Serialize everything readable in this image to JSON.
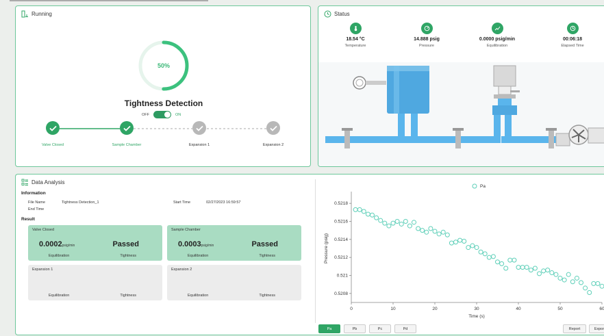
{
  "running": {
    "title": "Running",
    "progress_label": "50%",
    "progress_fraction": 0.5,
    "test_name": "Tightness Detection",
    "toggle_off": "OFF",
    "toggle_on": "ON",
    "toggle_state": "on",
    "steps": [
      {
        "label": "Valve Closed",
        "done": true
      },
      {
        "label": "Sample Chamber",
        "done": true
      },
      {
        "label": "Expansion 1",
        "done": false
      },
      {
        "label": "Expansion 2",
        "done": false
      }
    ]
  },
  "status": {
    "title": "Status",
    "items": [
      {
        "value": "18.54 °C",
        "label": "Temperature",
        "icon": "thermometer-icon"
      },
      {
        "value": "14.888 psig",
        "label": "Pressure",
        "icon": "gauge-icon"
      },
      {
        "value": "0.0000 psig/min",
        "label": "Equilibration",
        "icon": "trend-icon"
      },
      {
        "value": "00:06:18",
        "label": "Elapsed Time",
        "icon": "clock-icon"
      }
    ]
  },
  "analysis": {
    "title": "Data Analysis",
    "info_heading": "Information",
    "file_name_label": "File Name",
    "file_name": "Tightness Detection_1",
    "start_time_label": "Start Time",
    "start_time": "02/27/2023 16:59:57",
    "end_time_label": "End Time",
    "end_time": "",
    "result_heading": "Result",
    "cards": [
      {
        "title": "Valve Closed",
        "value": "0.0002",
        "unit": "psig/min",
        "status": "Passed",
        "left_label": "Equilibration",
        "right_label": "Tightness",
        "active": true
      },
      {
        "title": "Sample Chamber",
        "value": "0.0003",
        "unit": "psig/min",
        "status": "Passed",
        "left_label": "Equilibration",
        "right_label": "Tightness",
        "active": true
      },
      {
        "title": "Expansion 1",
        "value": "",
        "unit": "",
        "status": "",
        "left_label": "Equilibration",
        "right_label": "Tightness",
        "active": false
      },
      {
        "title": "Expansion 2",
        "value": "",
        "unit": "",
        "status": "",
        "left_label": "Equilibration",
        "right_label": "Tightness",
        "active": false
      }
    ]
  },
  "chart_tabs": [
    "Pa",
    "Pb",
    "Pc",
    "Pd"
  ],
  "chart_tab_active": "Pa",
  "report_label": "Report",
  "export_label": "Expor",
  "colors": {
    "accent": "#2fa565",
    "card_active": "#a9dcc2",
    "card_inactive": "#ececec",
    "point": "#5dcfb8"
  },
  "chart_data": {
    "type": "scatter",
    "title": "",
    "xlabel": "Time (s)",
    "ylabel": "Pressure (psig)",
    "xlim": [
      0,
      60
    ],
    "ylim": [
      0.5207,
      0.5219
    ],
    "xticks": [
      0,
      10,
      20,
      30,
      40,
      50,
      60
    ],
    "yticks": [
      0.5208,
      0.521,
      0.5212,
      0.5214,
      0.5216,
      0.5218
    ],
    "ytick_labels": [
      "0.5208",
      "0.521",
      "0.5212",
      "0.5214",
      "0.5216",
      "0.5218"
    ],
    "legend": "top-center",
    "series": [
      {
        "name": "Pa",
        "x": [
          1,
          2,
          3,
          4,
          5,
          6,
          7,
          8,
          9,
          10,
          11,
          12,
          13,
          14,
          15,
          16,
          17,
          18,
          19,
          20,
          21,
          22,
          23,
          24,
          25,
          26,
          27,
          28,
          29,
          30,
          31,
          32,
          33,
          34,
          35,
          36,
          37,
          38,
          39,
          40,
          41,
          42,
          43,
          44,
          45,
          46,
          47,
          48,
          49,
          50,
          51,
          52,
          53,
          54,
          55,
          56,
          57,
          58,
          59,
          60
        ],
        "y": [
          0.52173,
          0.52173,
          0.52171,
          0.52168,
          0.52167,
          0.52164,
          0.52161,
          0.52158,
          0.52155,
          0.52158,
          0.5216,
          0.52157,
          0.5216,
          0.52155,
          0.52159,
          0.52152,
          0.5215,
          0.52148,
          0.52152,
          0.52149,
          0.52146,
          0.52148,
          0.52145,
          0.52136,
          0.52137,
          0.52139,
          0.52138,
          0.52131,
          0.52133,
          0.52131,
          0.52126,
          0.52124,
          0.5212,
          0.52121,
          0.52115,
          0.52113,
          0.52108,
          0.52117,
          0.52117,
          0.52109,
          0.52109,
          0.52109,
          0.52106,
          0.52108,
          0.52102,
          0.52105,
          0.52106,
          0.52103,
          0.52101,
          0.52097,
          0.52095,
          0.52101,
          0.52093,
          0.52097,
          0.52092,
          0.52086,
          0.52081,
          0.52091,
          0.52091,
          0.52088
        ]
      }
    ]
  }
}
